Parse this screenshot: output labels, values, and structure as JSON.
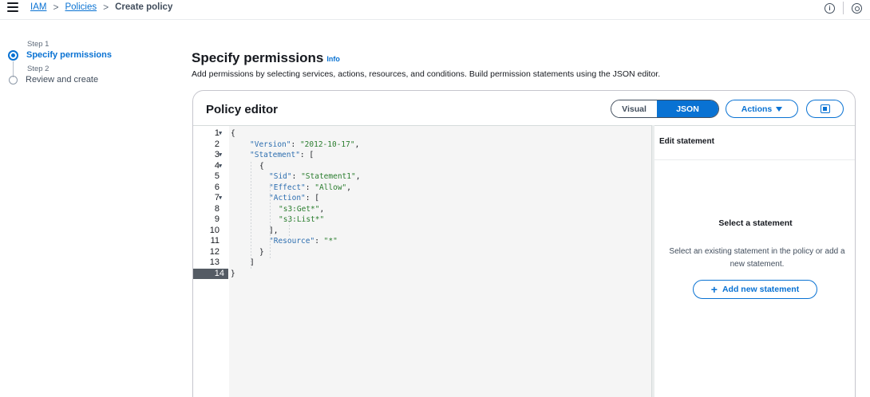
{
  "breadcrumb": {
    "items": [
      "IAM",
      "Policies"
    ],
    "current": "Create policy",
    "separator": ">"
  },
  "top_icons": [
    "info-icon",
    "settings-icon"
  ],
  "steps": [
    {
      "step": "Step 1",
      "label": "Specify permissions",
      "active": true
    },
    {
      "step": "Step 2",
      "label": "Review and create",
      "active": false
    }
  ],
  "page": {
    "title": "Specify permissions",
    "info": "Info",
    "subtitle": "Add permissions by selecting services, actions, resources, and conditions. Build permission statements using the JSON editor."
  },
  "editor": {
    "title": "Policy editor",
    "mode_visual": "Visual",
    "mode_json": "JSON",
    "actions_label": "Actions",
    "lines": [
      {
        "n": "1",
        "fold": true,
        "text": "{"
      },
      {
        "n": "2",
        "fold": false,
        "text": "\"Version\": \"2012-10-17\","
      },
      {
        "n": "3",
        "fold": true,
        "text": "\"Statement\": ["
      },
      {
        "n": "4",
        "fold": true,
        "text": "{"
      },
      {
        "n": "5",
        "fold": false,
        "text": "\"Sid\": \"Statement1\","
      },
      {
        "n": "6",
        "fold": false,
        "text": "\"Effect\": \"Allow\","
      },
      {
        "n": "7",
        "fold": true,
        "text": "\"Action\": ["
      },
      {
        "n": "8",
        "fold": false,
        "text": "\"s3:Get*\","
      },
      {
        "n": "9",
        "fold": false,
        "text": "\"s3:List*\""
      },
      {
        "n": "10",
        "fold": false,
        "text": "],"
      },
      {
        "n": "11",
        "fold": false,
        "text": "\"Resource\": \"*\""
      },
      {
        "n": "12",
        "fold": false,
        "text": "}"
      },
      {
        "n": "13",
        "fold": false,
        "text": "]"
      },
      {
        "n": "14",
        "fold": false,
        "text": "}",
        "active": true
      }
    ]
  },
  "statement_pane": {
    "title": "Edit statement",
    "empty_title": "Select a statement",
    "empty_desc": "Select an existing statement in the policy or add a new statement.",
    "add_button": "Add new statement"
  },
  "colors": {
    "accent": "#0972d3",
    "text": "#16191f",
    "json_key": "#2e6fb0",
    "json_string": "#2a7d2e"
  }
}
